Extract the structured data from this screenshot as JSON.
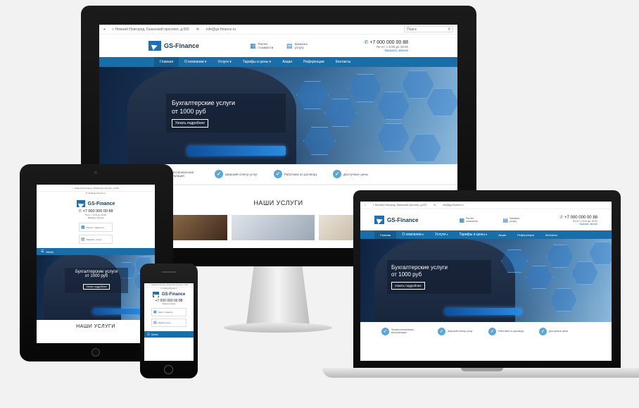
{
  "site": {
    "topbar_address": "г. Нижний Новгород, Казанский проспект, д.000",
    "topbar_email": "info@gs-finance.ru",
    "search_placeholder": "Поиск",
    "logo_text": "GS-Finance",
    "calc_label": "Расчет стоимости",
    "contract_label": "Заказать услугу",
    "phone": "+7 000 000 00 88",
    "hours": "Пн-пт: с 9:00 до 18:00",
    "callback": "Заказать звонок",
    "nav": [
      "Главная",
      "О компании",
      "Услуги",
      "Тарифы и цены",
      "Акции",
      "Референции",
      "Контакты"
    ],
    "menu_label": "Меню",
    "hero_title_1": "Бухгалтерские услуги",
    "hero_title_2": "от 1000 руб",
    "hero_button": "Узнать подробнее",
    "features": [
      "Профессиональная консультация",
      "Широкий спектр услуг",
      "Работаем по договору",
      "Доступные цены"
    ],
    "services_title": "НАШИ УСЛУГИ"
  },
  "colors": {
    "accent": "#1a6ea8",
    "logo": "#1f6fb4",
    "check": "#5fa7d3"
  }
}
